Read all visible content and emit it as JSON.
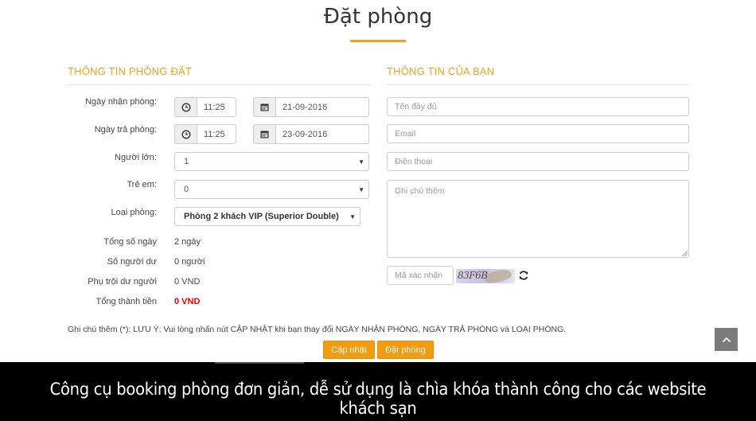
{
  "page": {
    "title": "Đặt phòng"
  },
  "room_section": {
    "heading": "THÔNG TIN PHÒNG ĐẶT",
    "checkin": {
      "label": "Ngày nhận phòng:",
      "time": "11:25",
      "date": "21-09-2016"
    },
    "checkout": {
      "label": "Ngày trả phòng:",
      "time": "11:25",
      "date": "23-09-2016"
    },
    "adults": {
      "label": "Người lớn:",
      "value": "1"
    },
    "children": {
      "label": "Trẻ em:",
      "value": "0"
    },
    "room_type": {
      "label": "Loại phòng:",
      "value": "Phòng 2 khách VIP (Superior Double)"
    },
    "summary": [
      {
        "label": "Tổng số ngày",
        "value": "2 ngày"
      },
      {
        "label": "Số người dư",
        "value": "0 người"
      },
      {
        "label": "Phụ trội dư người",
        "value": "0 VND"
      },
      {
        "label": "Tổng thành tiền",
        "value": "0 VND"
      }
    ]
  },
  "guest_section": {
    "heading": "THÔNG TIN CỦA BẠN",
    "name_placeholder": "Tên đầy đủ",
    "email_placeholder": "Email",
    "phone_placeholder": "Điện thoại",
    "notes_placeholder": "Ghi chú thêm",
    "captcha_placeholder": "Mã xác nhận",
    "captcha_text": "83F6B"
  },
  "footer_note": "Ghi chú thêm (*): LƯU Ý: Vui lòng nhấn nút CẬP NHẬT khi bạn thay đổi NGÀY NHẬN PHÒNG, NGÀY TRẢ PHÒNG và LOẠI PHÒNG.",
  "buttons": {
    "update": "Cập nhật",
    "book": "Đặt phòng"
  },
  "banner": {
    "text": "Công cụ booking phòng đơn giản, dễ sử dụng là chìa khóa thành công cho các website khách sạn"
  },
  "icons": {
    "clock": "clock-icon",
    "calendar": "calendar-icon",
    "refresh": "refresh-icon",
    "back_to_top": "chevron-up-icon"
  },
  "colors": {
    "accent": "#f0a21c",
    "button": "#f39c12",
    "total": "#e00000"
  }
}
